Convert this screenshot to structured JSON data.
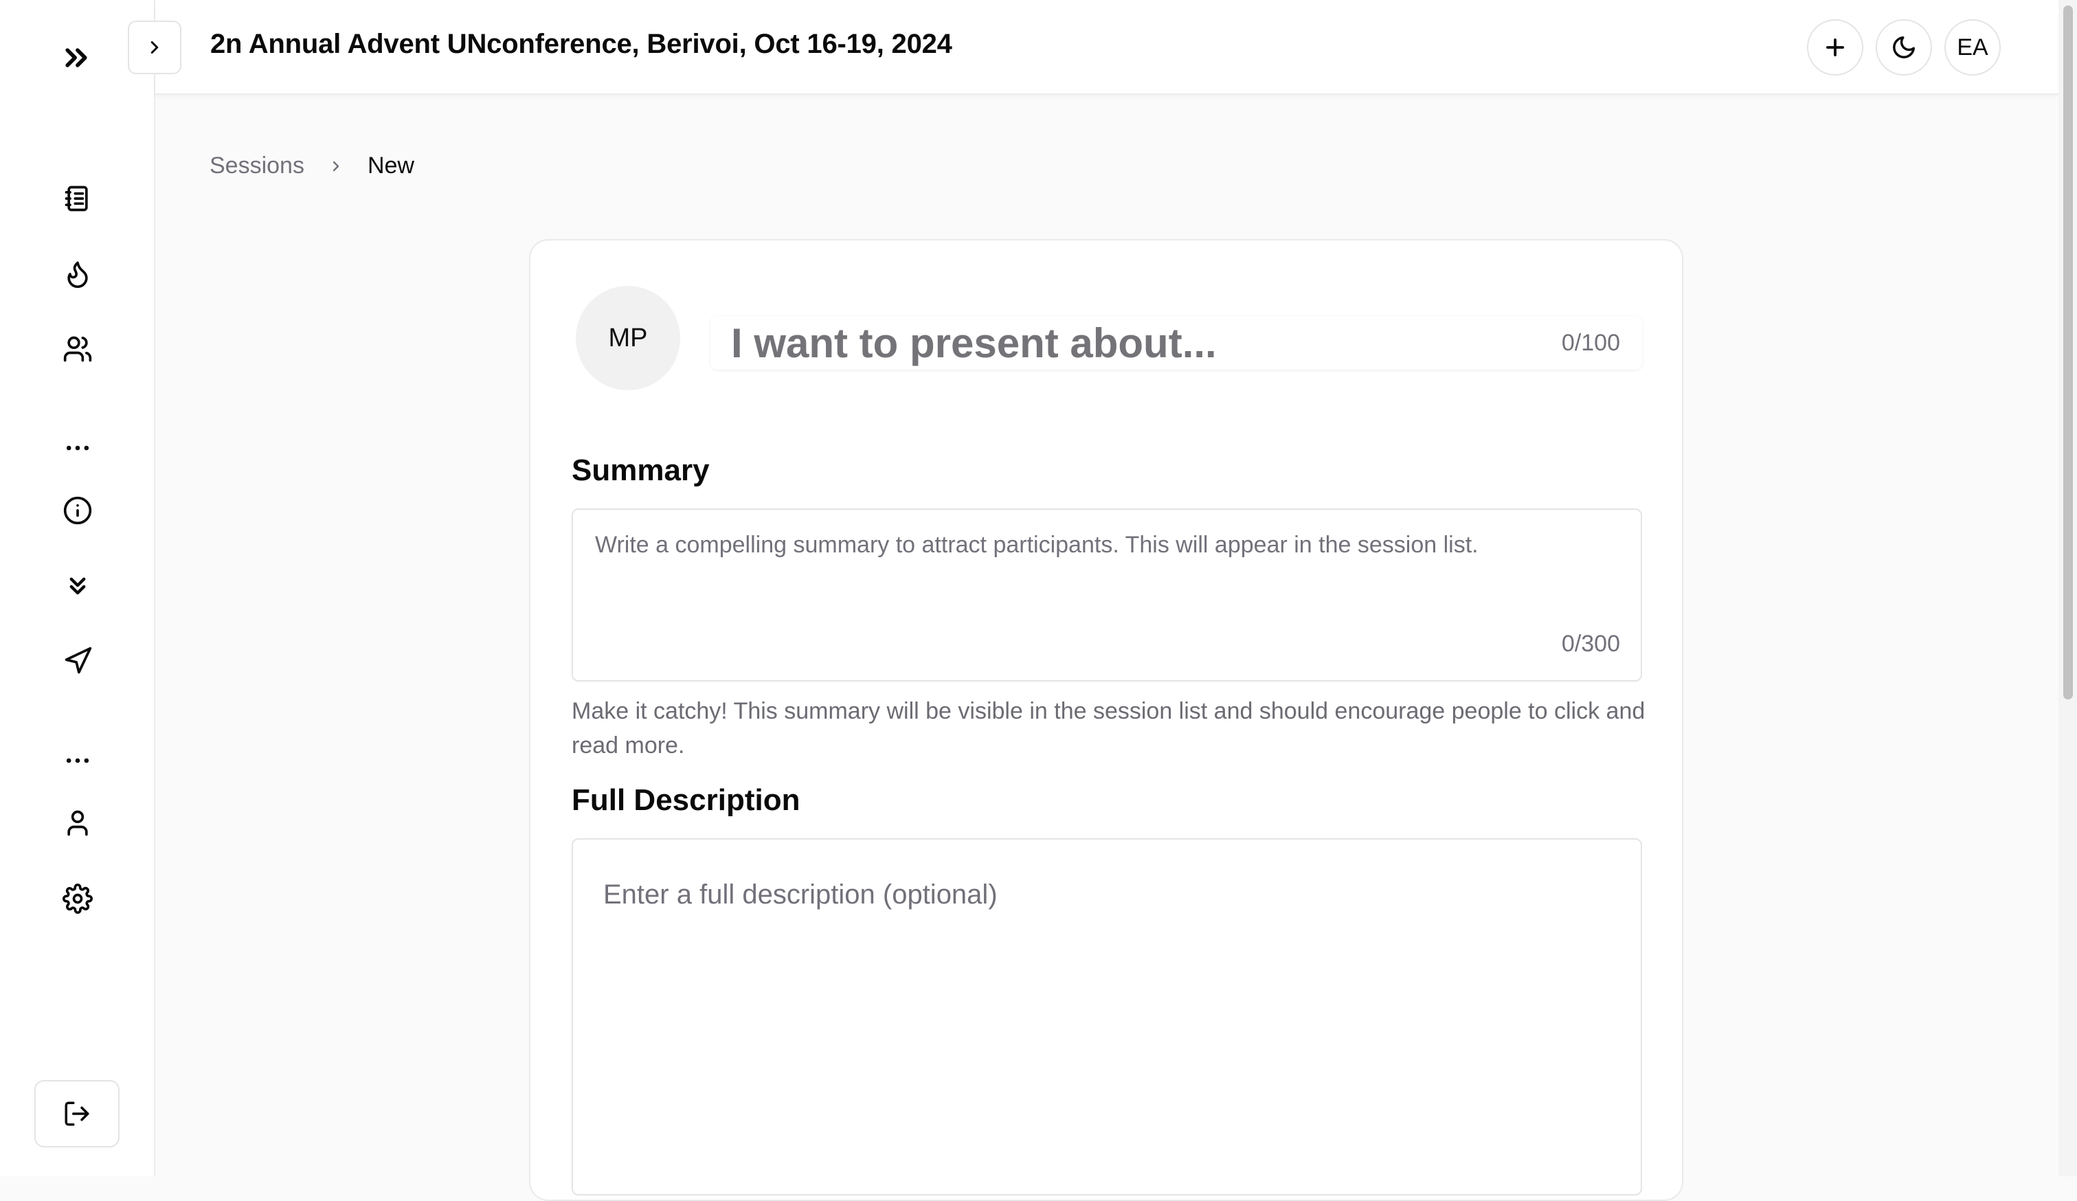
{
  "sidebar": {
    "items": [
      {
        "icon": "notebook-icon",
        "label": "Sessions"
      },
      {
        "icon": "flame-icon",
        "label": "Popular"
      },
      {
        "icon": "users-icon",
        "label": "People"
      },
      {
        "icon": "more-horizontal-icon",
        "label": "More"
      },
      {
        "icon": "info-icon",
        "label": "Info"
      },
      {
        "icon": "chevrons-down-icon",
        "label": "Expand"
      },
      {
        "icon": "send-icon",
        "label": "Send"
      },
      {
        "icon": "more-horizontal-icon",
        "label": "More"
      },
      {
        "icon": "user-icon",
        "label": "Profile"
      },
      {
        "icon": "settings-icon",
        "label": "Settings"
      }
    ],
    "logout_icon": "log-out-icon"
  },
  "header": {
    "title": "2n Annual Advent UNconference, Berivoi, Oct 16-19, 2024",
    "user_initials": "EA"
  },
  "breadcrumb": {
    "parent": "Sessions",
    "current": "New"
  },
  "form": {
    "avatar_initials": "MP",
    "title_placeholder": "I want to present about...",
    "title_value": "",
    "title_counter": "0/100",
    "summary_heading": "Summary",
    "summary_placeholder": "Write a compelling summary to attract participants. This will appear in the session list.",
    "summary_value": "",
    "summary_counter": "0/300",
    "summary_helper": "Make it catchy! This summary will be visible in the session list and should encourage people to click and read more.",
    "description_heading": "Full Description",
    "description_placeholder": "Enter a full description (optional)",
    "description_value": ""
  }
}
